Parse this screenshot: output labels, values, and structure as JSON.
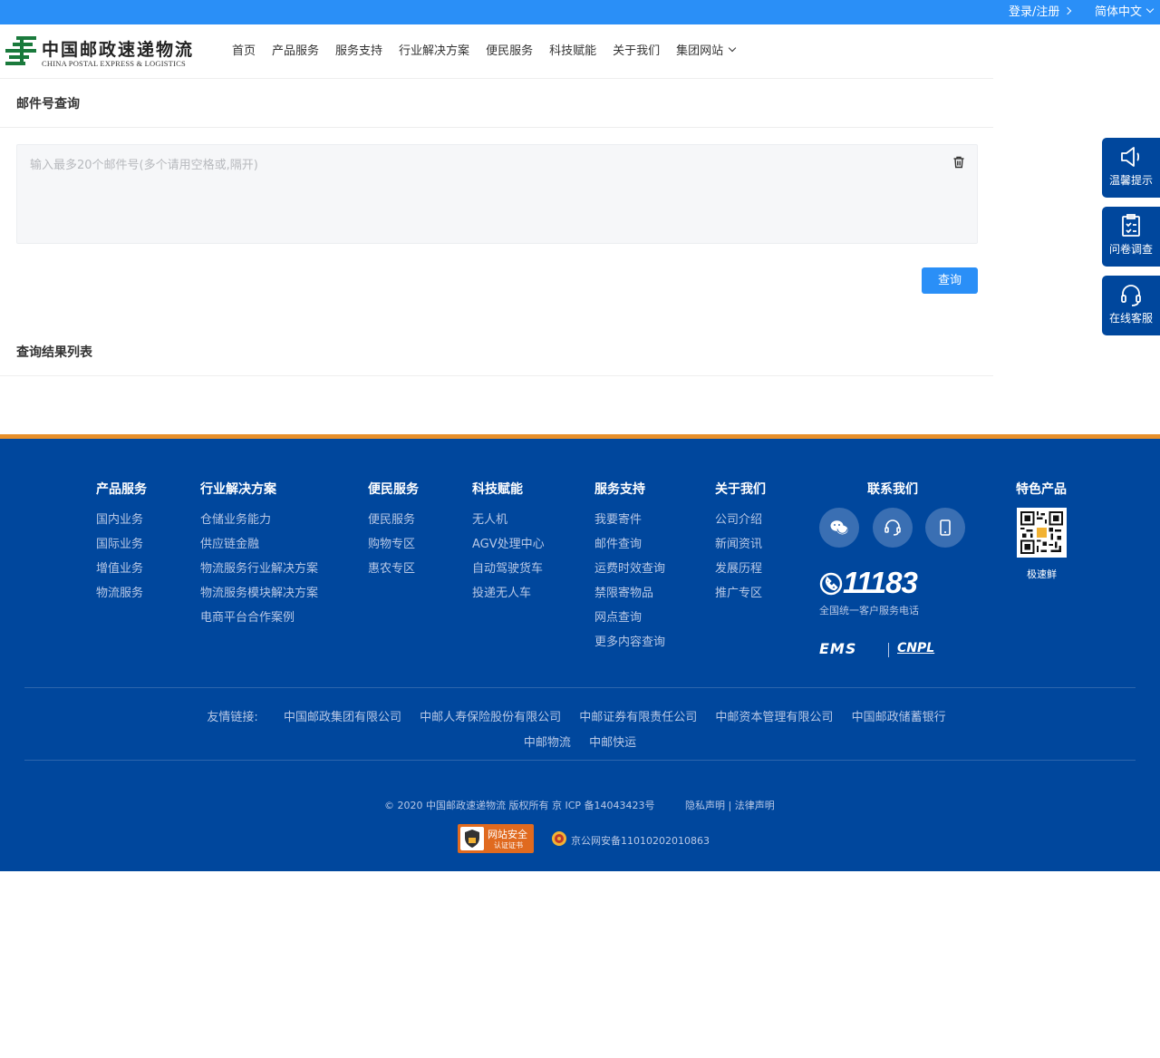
{
  "topbar": {
    "login": "登录/注册",
    "language": "简体中文"
  },
  "logo": {
    "cn": "中国邮政速递物流",
    "en": "CHINA POSTAL EXPRESS & LOGISTICS"
  },
  "nav": [
    "首页",
    "产品服务",
    "服务支持",
    "行业解决方案",
    "便民服务",
    "科技赋能",
    "关于我们",
    "集团网站"
  ],
  "query": {
    "title": "邮件号查询",
    "placeholder": "输入最多20个邮件号(多个请用空格或,隔开)",
    "button": "查询"
  },
  "results": {
    "title": "查询结果列表"
  },
  "side": [
    {
      "label": "温馨提示",
      "icon": "megaphone-icon"
    },
    {
      "label": "问卷调查",
      "icon": "clipboard-icon"
    },
    {
      "label": "在线客服",
      "icon": "headset-icon"
    }
  ],
  "footer": {
    "columns": [
      {
        "title": "产品服务",
        "items": [
          "国内业务",
          "国际业务",
          "增值业务",
          "物流服务"
        ]
      },
      {
        "title": "行业解决方案",
        "items": [
          "仓储业务能力",
          "供应链金融",
          "物流服务行业解决方案",
          "物流服务模块解决方案",
          "电商平台合作案例"
        ]
      },
      {
        "title": "便民服务",
        "items": [
          "便民服务",
          "购物专区",
          "惠农专区"
        ]
      },
      {
        "title": "科技赋能",
        "items": [
          "无人机",
          "AGV处理中心",
          "自动驾驶货车",
          "投递无人车"
        ]
      },
      {
        "title": "服务支持",
        "items": [
          "我要寄件",
          "邮件查询",
          "运费时效查询",
          "禁限寄物品",
          "网点查询",
          "更多内容查询"
        ]
      },
      {
        "title": "关于我们",
        "items": [
          "公司介绍",
          "新闻资讯",
          "发展历程",
          "推广专区"
        ]
      }
    ],
    "contact": {
      "title": "联系我们",
      "hotline": "11183",
      "hotline_desc": "全国统一客户服务电话",
      "brand1": "EMS",
      "brand2": "CNPL"
    },
    "special": {
      "title": "特色产品",
      "qr_label": "极速鲜"
    },
    "friend_label": "友情链接:",
    "friend_links": [
      "中国邮政集团有限公司",
      "中邮人寿保险股份有限公司",
      "中邮证券有限责任公司",
      "中邮资本管理有限公司",
      "中国邮政储蓄银行"
    ],
    "friend_links2": [
      "中邮物流",
      "中邮快运"
    ],
    "copyright": "© 2020 中国邮政速递物流 版权所有 京 ICP 备14043423号",
    "privacy": "隐私声明",
    "legal": "法律声明",
    "badge_title": "网站安全",
    "badge_sub": "认证证书",
    "police_record": "京公网安备11010202010863"
  },
  "colors": {
    "primary": "#2a8ff7",
    "footer": "#00479d",
    "accent": "#e8902b",
    "brand_green": "#1a7a3c"
  }
}
